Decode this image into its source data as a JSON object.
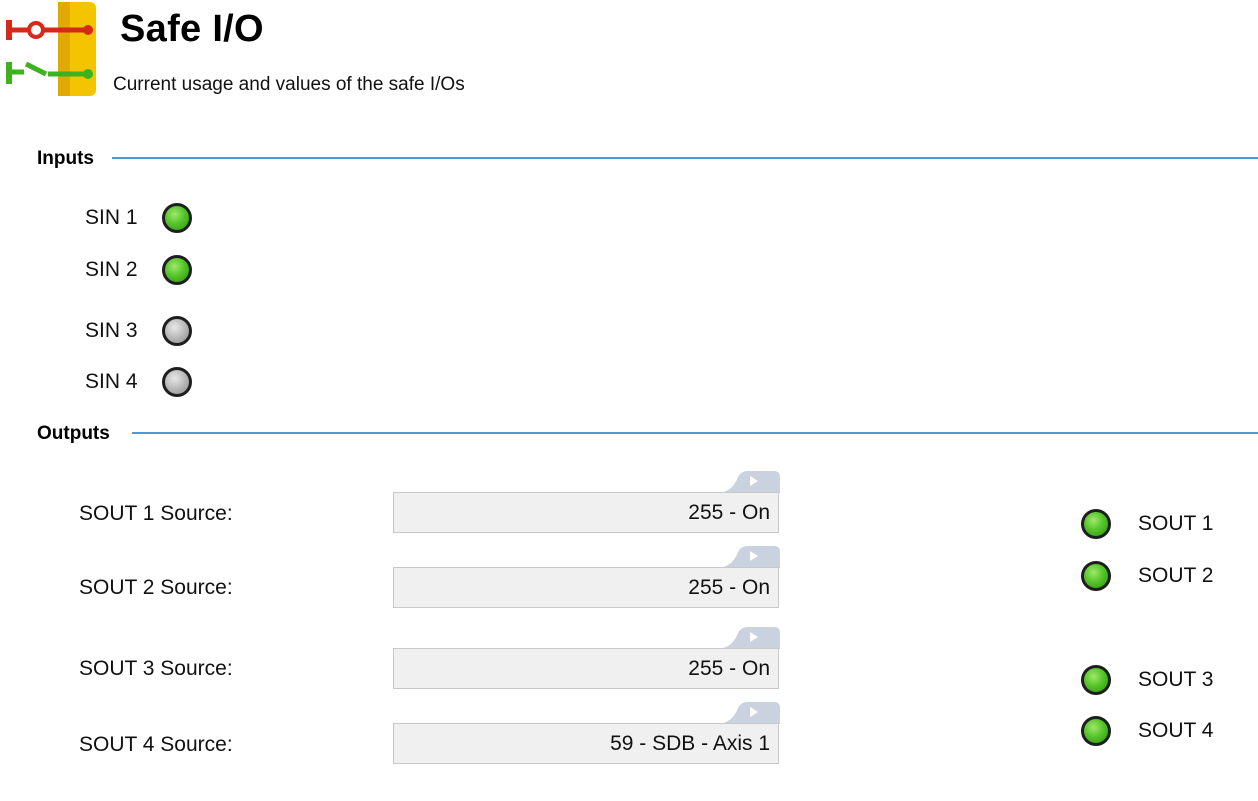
{
  "header": {
    "title": "Safe I/O",
    "subtitle": "Current usage and values of the safe I/Os",
    "icon": "safe-io-icon"
  },
  "inputs": {
    "label": "Inputs",
    "items": [
      {
        "label": "SIN 1",
        "state": "on"
      },
      {
        "label": "SIN 2",
        "state": "on"
      },
      {
        "label": "SIN 3",
        "state": "off"
      },
      {
        "label": "SIN 4",
        "state": "off"
      }
    ]
  },
  "outputs": {
    "label": "Outputs",
    "sources": [
      {
        "label": "SOUT 1 Source:",
        "value": "255 - On"
      },
      {
        "label": "SOUT 2 Source:",
        "value": "255 - On"
      },
      {
        "label": "SOUT 3 Source:",
        "value": "255 - On"
      },
      {
        "label": "SOUT 4 Source:",
        "value": "59 - SDB - Axis 1"
      }
    ],
    "leds": [
      {
        "label": "SOUT 1",
        "state": "on"
      },
      {
        "label": "SOUT 2",
        "state": "on"
      },
      {
        "label": "SOUT 3",
        "state": "on"
      },
      {
        "label": "SOUT 4",
        "state": "on"
      }
    ]
  },
  "colors": {
    "led_on": "#55c52a",
    "led_off": "#b8b8b8",
    "group_line": "#4a9ad8"
  }
}
